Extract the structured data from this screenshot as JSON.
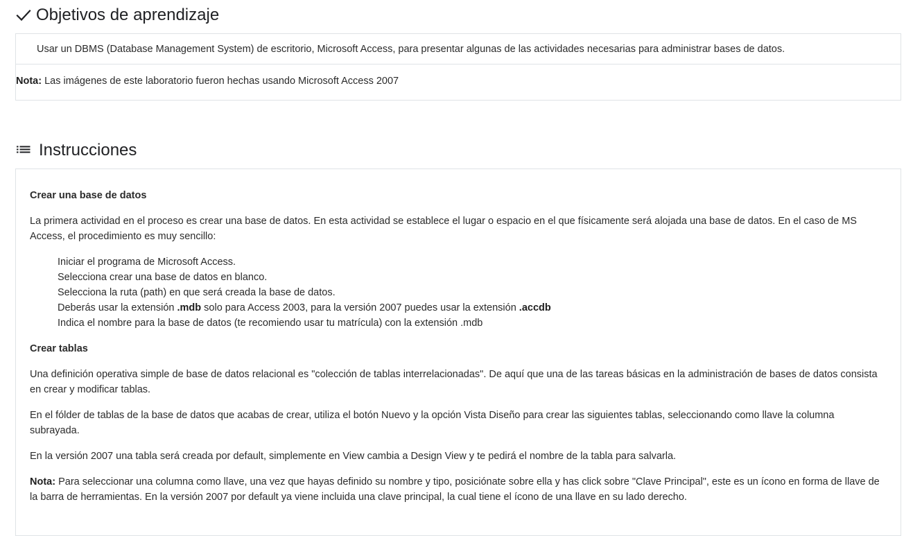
{
  "objetivos": {
    "title": "Objetivos de aprendizaje",
    "text": "Usar un DBMS (Database Management System) de escritorio, Microsoft Access, para presentar algunas de las actividades necesarias para administrar bases de datos.",
    "note_label": "Nota:",
    "note_text": " Las imágenes de este laboratorio fueron hechas usando Microsoft Access 2007"
  },
  "instrucciones": {
    "title": "Instrucciones",
    "section1_heading": "Crear una base de datos",
    "section1_para": "La primera actividad en el proceso es crear una base de datos. En esta actividad se establece el lugar o espacio en el que físicamente será alojada una base de datos. En el caso de MS Access, el procedimiento es muy sencillo:",
    "steps": {
      "s1": "Iniciar el programa de Microsoft Access.",
      "s2": "Selecciona crear una base de datos en blanco.",
      "s3": "Selecciona la ruta (path) en que será creada la base de datos.",
      "s4_a": "Deberás usar la extensión ",
      "s4_b": ".mdb",
      "s4_c": " solo para Access 2003, para la versión 2007 puedes usar la extensión ",
      "s4_d": ".accdb",
      "s5": "Indica el nombre para la base de datos (te recomiendo usar tu matrícula) con la extensión .mdb"
    },
    "section2_heading": "Crear tablas",
    "section2_para1": "Una definición operativa simple de base de datos relacional es \"colección de tablas interrelacionadas\". De aquí que una de las tareas básicas en la administración de bases de datos consista en crear y modificar tablas.",
    "section2_para2": "En el fólder de tablas de la base de datos que acabas de crear, utiliza el botón Nuevo y la opción Vista Diseño para crear las siguientes tablas, seleccionando como llave la columna subrayada.",
    "section2_para3": "En la versión 2007 una tabla será creada por default, simplemente en View cambia a Design View y te pedirá el nombre de la tabla para salvarla.",
    "note_label": "Nota:",
    "note_text": " Para seleccionar una columna como llave, una vez que hayas definido su nombre y tipo, posiciónate sobre ella y has click sobre \"Clave Principal\", este es un ícono en forma de llave de la barra de herramientas. En la versión 2007 por default ya viene incluida una clave principal, la cual tiene el ícono de una llave en su lado derecho."
  },
  "icons": {
    "objetivos": "check-icon",
    "instrucciones": "list-icon"
  }
}
